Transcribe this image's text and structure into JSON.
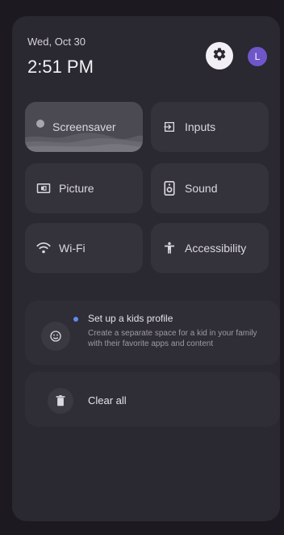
{
  "header": {
    "date": "Wed, Oct 30",
    "time": "2:51 PM",
    "avatar_initial": "L"
  },
  "tiles": [
    {
      "label": "Screensaver",
      "icon": "screensaver-dot",
      "selected": true
    },
    {
      "label": "Inputs",
      "icon": "input-icon"
    },
    {
      "label": "Picture",
      "icon": "picture-icon"
    },
    {
      "label": "Sound",
      "icon": "speaker-icon"
    },
    {
      "label": "Wi-Fi",
      "icon": "wifi-icon"
    },
    {
      "label": "Accessibility",
      "icon": "accessibility-icon"
    }
  ],
  "kids_card": {
    "title": "Set up a kids profile",
    "description": "Create a separate space for a kid in your family with their favorite apps and content"
  },
  "clear_all": {
    "label": "Clear all"
  },
  "colors": {
    "background": "#1c1a20",
    "panel": "#2a2830",
    "tile": "#34323a",
    "tile_selected": "#4b4952",
    "avatar": "#6f56c9",
    "notification_dot": "#5a8df0"
  }
}
